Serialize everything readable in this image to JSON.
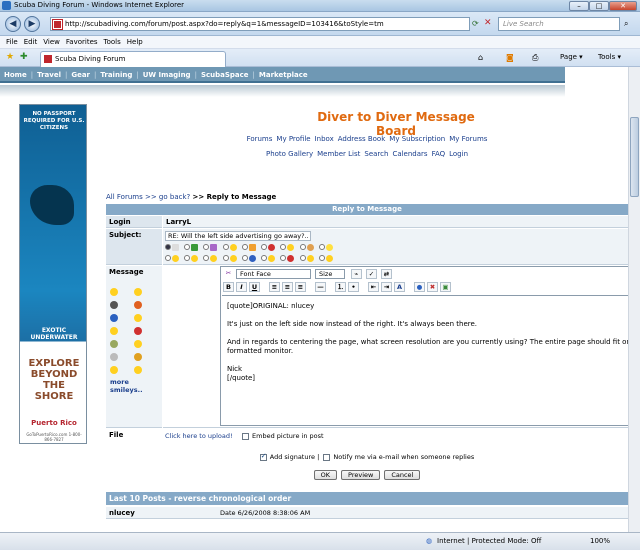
{
  "window": {
    "title": "Scuba Diving Forum - Windows Internet Explorer",
    "min": "–",
    "max": "□",
    "close": "✕"
  },
  "address": {
    "url": "http://scubadiving.com/forum/post.aspx?do=reply&q=1&messageID=103416&toStyle=tm",
    "search_placeholder": "Live Search",
    "back": "◀",
    "forward": "▶"
  },
  "menu": [
    "File",
    "Edit",
    "View",
    "Favorites",
    "Tools",
    "Help"
  ],
  "tab": {
    "label": "Scuba Diving Forum",
    "page": "Page ▾",
    "tools": "Tools ▾"
  },
  "sitenav": {
    "items": [
      "Home",
      "Travel",
      "Gear",
      "Training",
      "UW Imaging",
      "ScubaSpace",
      "Marketplace"
    ],
    "sep": "|"
  },
  "ad": {
    "line1": "NO PASSPORT REQUIRED FOR U.S. CITIZENS",
    "line2": "EXOTIC UNDERWATER ENCHANTMENTS",
    "line3": "EXPLORE BEYOND THE SHORE",
    "brand": "Puerto Rico",
    "small": "GoToPuertoRico.com 1-800-866-7827"
  },
  "board": {
    "title": "Diver to Diver Message Board",
    "links1": [
      "Forums",
      "My Profile",
      "Inbox",
      "Address Book",
      "My Subscription",
      "My Forums"
    ],
    "links2": [
      "Photo Gallery",
      "Member List",
      "Search",
      "Calendars",
      "FAQ",
      "Login"
    ]
  },
  "breadcrumb": {
    "all": "All Forums >> go back?",
    "current": ">> Reply to Message"
  },
  "form": {
    "header": "Reply to Message",
    "login_label": "Login",
    "login_value": "LarryL",
    "subject_label": "Subject:",
    "subject_value": "RE: Will the left side advertising go away?..",
    "message_label": "Message",
    "more_smileys": "more smileys..",
    "font_select": "Font Face",
    "size_select": "Size",
    "tb_bold": "B",
    "tb_italic": "I",
    "tb_underline": "U",
    "message_lines": [
      "[quote]ORIGINAL: nlucey",
      "It's just on the left side now instead of the right. It's always been there.",
      "And in regards to centering the page, what screen resolution are you currently using? The entire page should fit on a standard",
      "formatted monitor.",
      "Nick",
      "[/quote]"
    ],
    "file_label": "File",
    "upload_link": "Click here to upload!",
    "embed_label": "Embed picture in post",
    "add_signature": "Add signature |",
    "notify": "Notify me via e-mail when someone replies",
    "ok": "OK",
    "preview": "Preview",
    "cancel": "Cancel"
  },
  "last10": {
    "header": "Last 10 Posts - reverse chronological order",
    "user": "nlucey",
    "date": "Date 6/26/2008 8:38:06 AM"
  },
  "status": {
    "zone": "Internet | Protected Mode: Off",
    "zoom": "100%"
  }
}
